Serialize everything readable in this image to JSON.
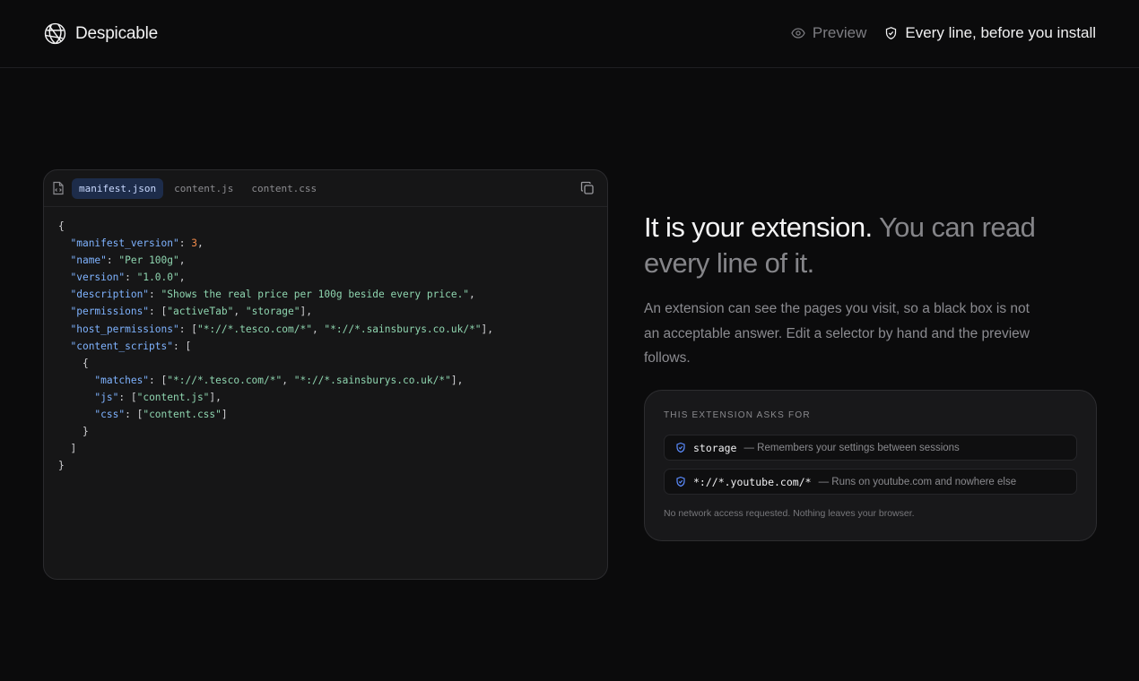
{
  "header": {
    "brand": "Despicable",
    "nav_preview": "Preview",
    "nav_install": "Every line, before you install"
  },
  "code_panel": {
    "tabs": [
      "manifest.json",
      "content.js",
      "content.css"
    ],
    "active_tab": "manifest.json",
    "lines": [
      [
        [
          "p",
          "{"
        ]
      ],
      [
        [
          "p",
          "  "
        ],
        [
          "k",
          "\"manifest_version\""
        ],
        [
          "p",
          ": "
        ],
        [
          "n",
          "3"
        ],
        [
          "p",
          ","
        ]
      ],
      [
        [
          "p",
          "  "
        ],
        [
          "k",
          "\"name\""
        ],
        [
          "p",
          ": "
        ],
        [
          "s",
          "\"Per 100g\""
        ],
        [
          "p",
          ","
        ]
      ],
      [
        [
          "p",
          "  "
        ],
        [
          "k",
          "\"version\""
        ],
        [
          "p",
          ": "
        ],
        [
          "s",
          "\"1.0.0\""
        ],
        [
          "p",
          ","
        ]
      ],
      [
        [
          "p",
          "  "
        ],
        [
          "k",
          "\"description\""
        ],
        [
          "p",
          ": "
        ],
        [
          "s",
          "\"Shows the real price per 100g beside every price.\""
        ],
        [
          "p",
          ","
        ]
      ],
      [
        [
          "p",
          "  "
        ],
        [
          "k",
          "\"permissions\""
        ],
        [
          "p",
          ": ["
        ],
        [
          "s",
          "\"activeTab\""
        ],
        [
          "p",
          ", "
        ],
        [
          "s",
          "\"storage\""
        ],
        [
          "p",
          "],"
        ]
      ],
      [
        [
          "p",
          "  "
        ],
        [
          "k",
          "\"host_permissions\""
        ],
        [
          "p",
          ": ["
        ],
        [
          "s",
          "\"*://*.tesco.com/*\""
        ],
        [
          "p",
          ", "
        ],
        [
          "s",
          "\"*://*.sainsburys.co.uk/*\""
        ],
        [
          "p",
          "],"
        ]
      ],
      [
        [
          "p",
          "  "
        ],
        [
          "k",
          "\"content_scripts\""
        ],
        [
          "p",
          ": ["
        ]
      ],
      [
        [
          "p",
          "    {"
        ]
      ],
      [
        [
          "p",
          "      "
        ],
        [
          "k",
          "\"matches\""
        ],
        [
          "p",
          ": ["
        ],
        [
          "s",
          "\"*://*.tesco.com/*\""
        ],
        [
          "p",
          ", "
        ],
        [
          "s",
          "\"*://*.sainsburys.co.uk/*\""
        ],
        [
          "p",
          "],"
        ]
      ],
      [
        [
          "p",
          "      "
        ],
        [
          "k",
          "\"js\""
        ],
        [
          "p",
          ": ["
        ],
        [
          "s",
          "\"content.js\""
        ],
        [
          "p",
          "],"
        ]
      ],
      [
        [
          "p",
          "      "
        ],
        [
          "k",
          "\"css\""
        ],
        [
          "p",
          ": ["
        ],
        [
          "s",
          "\"content.css\""
        ],
        [
          "p",
          "]"
        ]
      ],
      [
        [
          "p",
          "    }"
        ]
      ],
      [
        [
          "p",
          "  ]"
        ]
      ],
      [
        [
          "p",
          "}"
        ]
      ]
    ]
  },
  "headline": {
    "strong": "It is your extension.",
    "muted": "You can read every line of it."
  },
  "lede": "An extension can see the pages you visit, so a black box is not an acceptable answer. Edit a selector by hand and the preview follows.",
  "permissions": {
    "title": "THIS EXTENSION ASKS FOR",
    "items": [
      {
        "key": "storage",
        "desc": "— Remembers your settings between sessions"
      },
      {
        "key": "*://*.youtube.com/*",
        "desc": "— Runs on youtube.com and nowhere else"
      }
    ],
    "footer": "No network access requested. Nothing leaves your browser."
  },
  "colors": {
    "accent": "#5b8cff",
    "json_key": "#7fb3ff",
    "json_string": "#8fd6b0",
    "json_number": "#f08a4b"
  }
}
